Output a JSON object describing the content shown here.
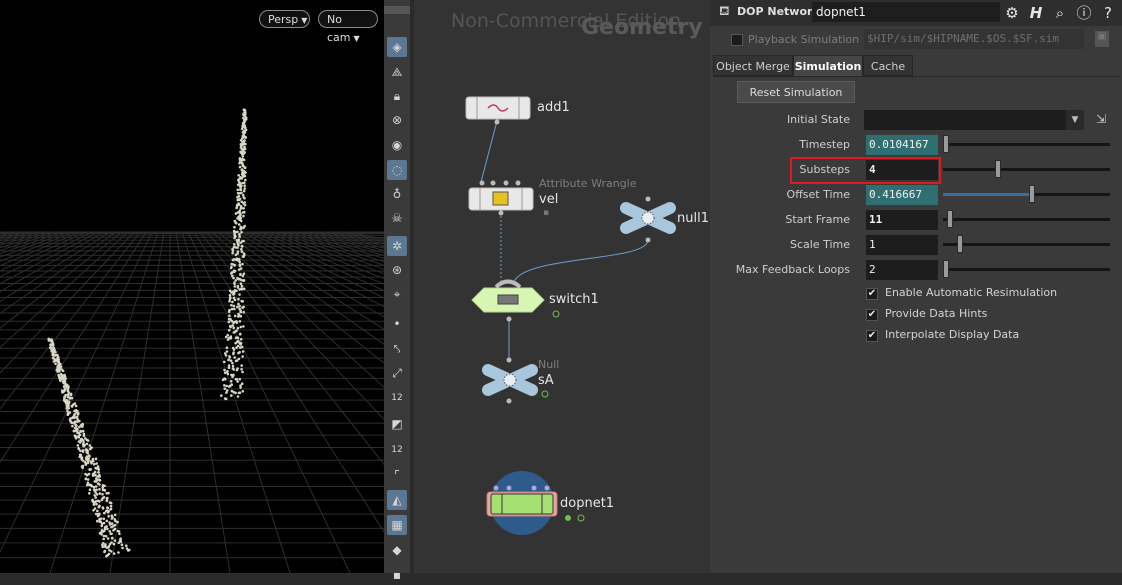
{
  "viewport": {
    "camera_button": "Persp",
    "cam_select": "No cam"
  },
  "toolshelf": {
    "icons": [
      "select-icon",
      "view-icon",
      "lock-icon",
      "pose-icon",
      "sphere-icon",
      "light-icon",
      "light-bulb-icon",
      "skull-icon",
      "snap-icon",
      "eye-icon",
      "camera-icon",
      "point-icon",
      "brush-icon",
      "dropper-icon",
      "twelve-icon",
      "paint-icon",
      "twelve-alt-icon",
      "corner-icon",
      "geo-icon",
      "checker-icon",
      "diamond-icon",
      "misc-icon"
    ],
    "numbers": [
      "12",
      "12"
    ]
  },
  "network": {
    "watermark": "Non-Commercial Edition",
    "context_title": "Geometry",
    "nodes": {
      "add1": {
        "name": "add1"
      },
      "vel": {
        "type": "Attribute Wrangle",
        "name": "vel"
      },
      "null1": {
        "name": "null1"
      },
      "switch1": {
        "name": "switch1"
      },
      "sA": {
        "type": "Null",
        "name": "sA"
      },
      "dopnet1": {
        "name": "dopnet1"
      }
    }
  },
  "params": {
    "node_type": "DOP Network",
    "node_name": "dopnet1",
    "playback_label": "Playback Simulation",
    "playback_path": "$HIP/sim/$HIPNAME.$OS.$SF.sim",
    "tabs": [
      "Object Merge",
      "Simulation",
      "Cache"
    ],
    "active_tab": "Simulation",
    "reset_button": "Reset Simulation",
    "initial_state_label": "Initial State",
    "initial_state_value": "",
    "rows": [
      {
        "label": "Timestep",
        "value": "0.0104167",
        "slider": 0.0
      },
      {
        "label": "Substeps",
        "value": "4",
        "slider": 0.33
      },
      {
        "label": "Offset Time",
        "value": "0.416667",
        "slider": 0.53
      },
      {
        "label": "Start Frame",
        "value": "11",
        "slider": 0.03
      },
      {
        "label": "Scale Time",
        "value": "1",
        "slider": 0.1
      },
      {
        "label": "Max Feedback Loops",
        "value": "2",
        "slider": 0.0
      }
    ],
    "checkboxes": [
      {
        "label": "Enable Automatic Resimulation",
        "checked": true
      },
      {
        "label": "Provide Data Hints",
        "checked": true
      },
      {
        "label": "Interpolate Display Data",
        "checked": true
      }
    ],
    "checkmark": "✔"
  }
}
